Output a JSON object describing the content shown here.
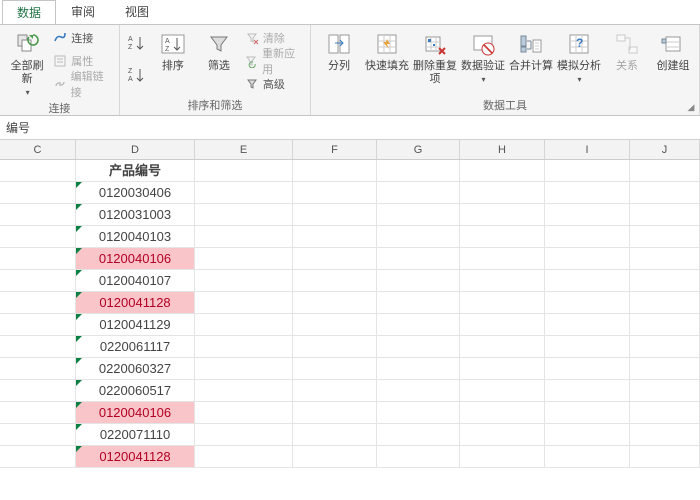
{
  "tabs": {
    "data": "数据",
    "review": "审阅",
    "view": "视图"
  },
  "ribbon": {
    "connections": {
      "refresh": "全部刷新",
      "conn": "连接",
      "props": "属性",
      "edit_links": "编辑链接",
      "label": "连接"
    },
    "sort": {
      "asc": "A↓Z",
      "desc": "Z↓A",
      "sort": "排序",
      "filter": "筛选",
      "clear": "清除",
      "reapply": "重新应用",
      "advanced": "高级",
      "label": "排序和筛选"
    },
    "tools": {
      "text_to_cols": "分列",
      "flash_fill": "快速填充",
      "remove_dup": "删除重复项",
      "data_val": "数据验证",
      "consolidate": "合并计算",
      "whatif": "模拟分析",
      "relations": "关系",
      "create_group": "创建组",
      "label": "数据工具"
    }
  },
  "formula_bar": {
    "text": "编号"
  },
  "columns": [
    "C",
    "D",
    "E",
    "F",
    "G",
    "H",
    "I",
    "J"
  ],
  "header_cell": "产品编号",
  "rows": [
    {
      "v": "0120030406",
      "hl": false
    },
    {
      "v": "0120031003",
      "hl": false
    },
    {
      "v": "0120040103",
      "hl": false
    },
    {
      "v": "0120040106",
      "hl": true
    },
    {
      "v": "0120040107",
      "hl": false
    },
    {
      "v": "0120041128",
      "hl": true
    },
    {
      "v": "0120041129",
      "hl": false
    },
    {
      "v": "0220061117",
      "hl": false
    },
    {
      "v": "0220060327",
      "hl": false
    },
    {
      "v": "0220060517",
      "hl": false
    },
    {
      "v": "0120040106",
      "hl": true
    },
    {
      "v": "0220071110",
      "hl": false
    },
    {
      "v": "0120041128",
      "hl": true
    }
  ]
}
